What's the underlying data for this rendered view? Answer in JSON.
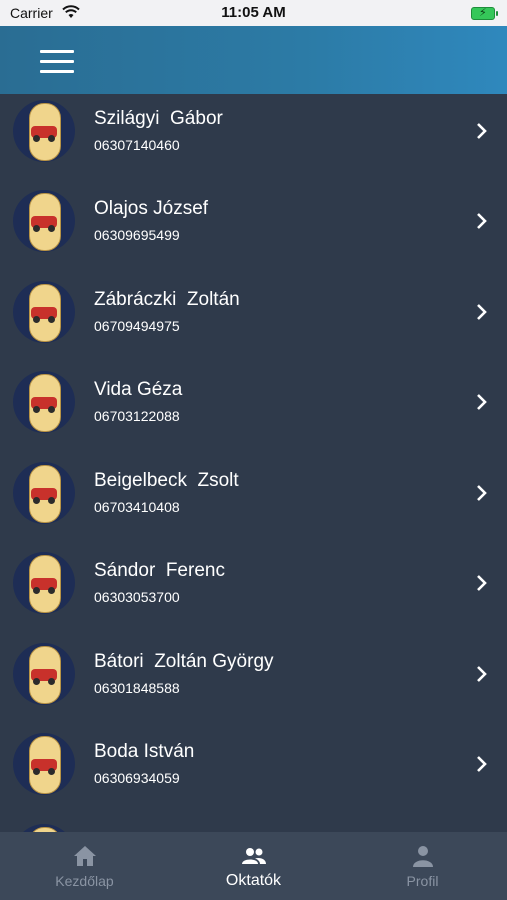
{
  "status_bar": {
    "carrier": "Carrier",
    "time": "11:05 AM"
  },
  "navbar": {
    "menu_icon": "hamburger-menu-icon"
  },
  "instructors": [
    {
      "name": "Szilágyi  Gábor",
      "phone": "06307140460"
    },
    {
      "name": "Olajos József",
      "phone": "06309695499"
    },
    {
      "name": "Zábráczki  Zoltán",
      "phone": "06709494975"
    },
    {
      "name": "Vida Géza",
      "phone": "06703122088"
    },
    {
      "name": "Beigelbeck  Zsolt",
      "phone": "06703410408"
    },
    {
      "name": "Sándor  Ferenc",
      "phone": "06303053700"
    },
    {
      "name": "Bátori  Zoltán György",
      "phone": "06301848588"
    },
    {
      "name": "Boda István",
      "phone": "06306934059"
    }
  ],
  "tabs": [
    {
      "label": "Kezdőlap",
      "icon": "home-icon",
      "active": false
    },
    {
      "label": "Oktatók",
      "icon": "users-icon",
      "active": true
    },
    {
      "label": "Profil",
      "icon": "person-icon",
      "active": false
    }
  ],
  "colors": {
    "active_tab": "#ffffff",
    "inactive_tab": "#8a94a3",
    "nav_gradient_end": "#2f88bd"
  }
}
